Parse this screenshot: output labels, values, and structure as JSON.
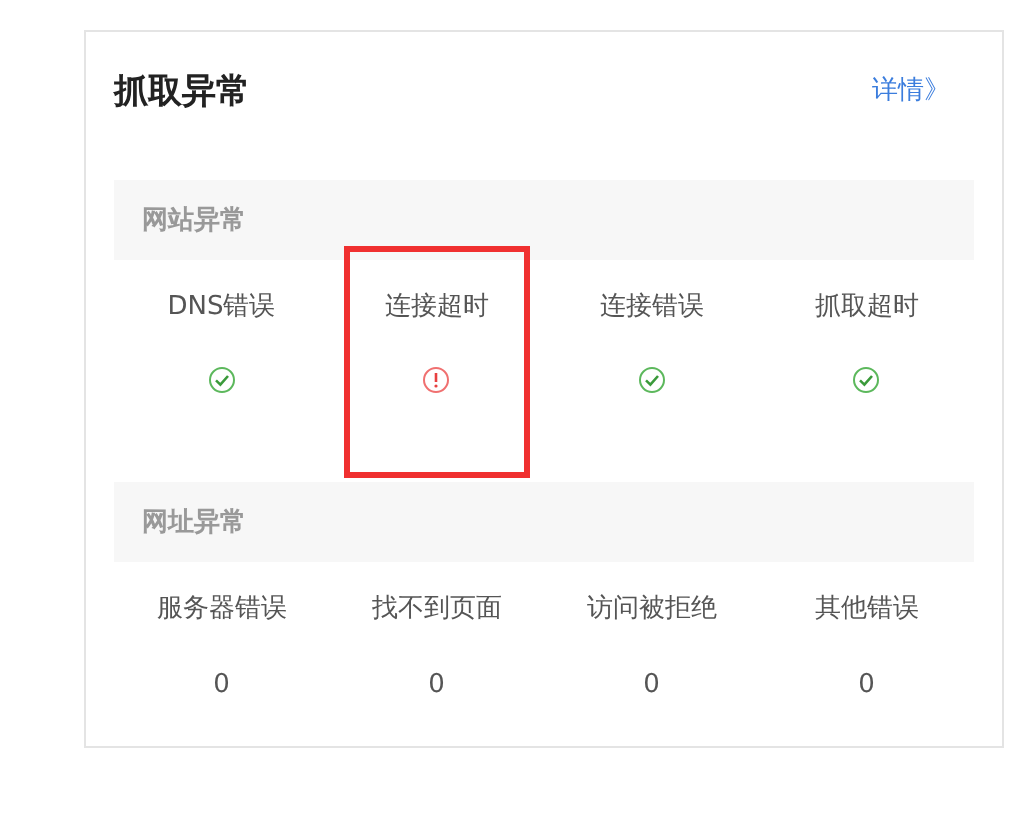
{
  "card": {
    "title": "抓取异常",
    "details_link": "详情》"
  },
  "sections": [
    {
      "title": "网站异常",
      "items": [
        {
          "label": "DNS错误",
          "kind": "status",
          "error": false,
          "highlighted": false
        },
        {
          "label": "连接超时",
          "kind": "status",
          "error": true,
          "highlighted": true
        },
        {
          "label": "连接错误",
          "kind": "status",
          "error": false,
          "highlighted": false
        },
        {
          "label": "抓取超时",
          "kind": "status",
          "error": false,
          "highlighted": false
        }
      ]
    },
    {
      "title": "网址异常",
      "items": [
        {
          "label": "服务器错误",
          "kind": "count",
          "value": "0",
          "highlighted": false
        },
        {
          "label": "找不到页面",
          "kind": "count",
          "value": "0",
          "highlighted": false
        },
        {
          "label": "访问被拒绝",
          "kind": "count",
          "value": "0",
          "highlighted": false
        },
        {
          "label": "其他错误",
          "kind": "count",
          "value": "0",
          "highlighted": false
        }
      ]
    }
  ]
}
